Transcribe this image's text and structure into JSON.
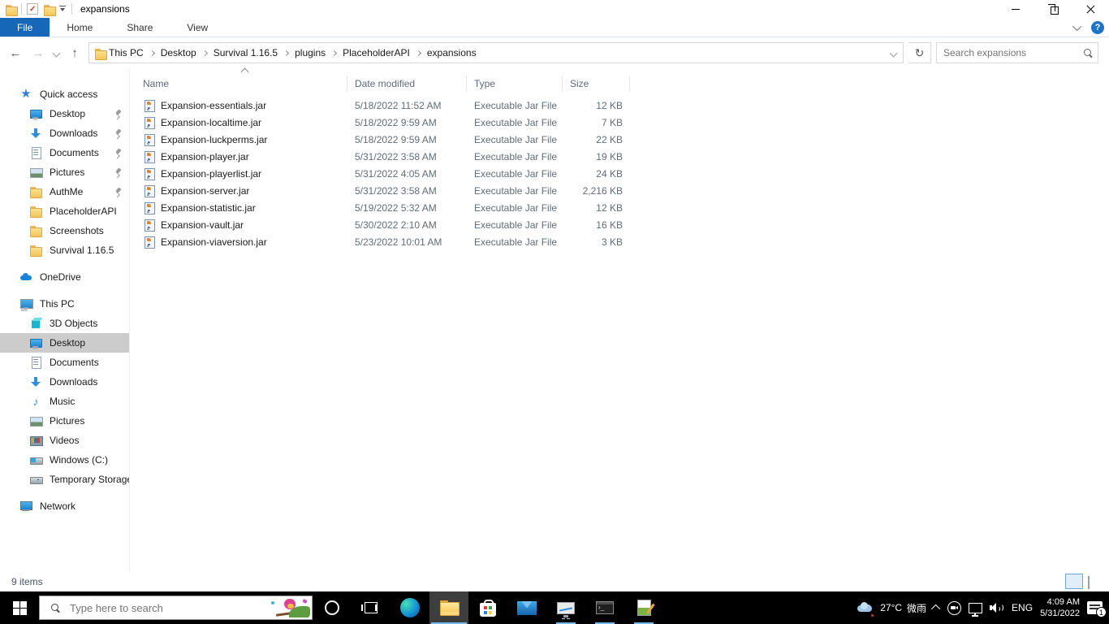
{
  "colors": {
    "accent_blue": "#1667b8",
    "selection_gray": "#cccccc",
    "taskbar_underline": "#76b9ed",
    "folder_yellow": "#f2c55e"
  },
  "titlebar": {
    "title": "expansions",
    "qat_icons": [
      "folder-icon",
      "properties-check-icon",
      "new-folder-icon",
      "customize-chevron-icon"
    ]
  },
  "ribbon": {
    "tabs": [
      "File",
      "Home",
      "Share",
      "View"
    ],
    "active_tab": "File",
    "help_label": "?"
  },
  "addressbar": {
    "breadcrumb": [
      "This PC",
      "Desktop",
      "Survival 1.16.5",
      "plugins",
      "PlaceholderAPI",
      "expansions"
    ],
    "search_placeholder": "Search expansions"
  },
  "sidebar": {
    "items": [
      {
        "label": "Quick access",
        "icon": "star",
        "level": 0,
        "pinned": false,
        "selected": false,
        "gap": false
      },
      {
        "label": "Desktop",
        "icon": "desktop",
        "level": 1,
        "pinned": true,
        "selected": false,
        "gap": false
      },
      {
        "label": "Downloads",
        "icon": "download",
        "level": 1,
        "pinned": true,
        "selected": false,
        "gap": false
      },
      {
        "label": "Documents",
        "icon": "document",
        "level": 1,
        "pinned": true,
        "selected": false,
        "gap": false
      },
      {
        "label": "Pictures",
        "icon": "picture",
        "level": 1,
        "pinned": true,
        "selected": false,
        "gap": false
      },
      {
        "label": "AuthMe",
        "icon": "folder",
        "level": 1,
        "pinned": true,
        "selected": false,
        "gap": false
      },
      {
        "label": "PlaceholderAPI",
        "icon": "folder",
        "level": 1,
        "pinned": false,
        "selected": false,
        "gap": false
      },
      {
        "label": "Screenshots",
        "icon": "folder",
        "level": 1,
        "pinned": false,
        "selected": false,
        "gap": false
      },
      {
        "label": "Survival 1.16.5",
        "icon": "folder",
        "level": 1,
        "pinned": false,
        "selected": false,
        "gap": false
      },
      {
        "label": "OneDrive",
        "icon": "cloud",
        "level": 0,
        "pinned": false,
        "selected": false,
        "gap": true
      },
      {
        "label": "This PC",
        "icon": "pc",
        "level": 0,
        "pinned": false,
        "selected": false,
        "gap": true
      },
      {
        "label": "3D Objects",
        "icon": "cube",
        "level": 1,
        "pinned": false,
        "selected": false,
        "gap": false
      },
      {
        "label": "Desktop",
        "icon": "desktop",
        "level": 1,
        "pinned": false,
        "selected": true,
        "gap": false
      },
      {
        "label": "Documents",
        "icon": "document",
        "level": 1,
        "pinned": false,
        "selected": false,
        "gap": false
      },
      {
        "label": "Downloads",
        "icon": "download",
        "level": 1,
        "pinned": false,
        "selected": false,
        "gap": false
      },
      {
        "label": "Music",
        "icon": "music",
        "level": 1,
        "pinned": false,
        "selected": false,
        "gap": false
      },
      {
        "label": "Pictures",
        "icon": "picture",
        "level": 1,
        "pinned": false,
        "selected": false,
        "gap": false
      },
      {
        "label": "Videos",
        "icon": "video",
        "level": 1,
        "pinned": false,
        "selected": false,
        "gap": false
      },
      {
        "label": "Windows (C:)",
        "icon": "disk-os",
        "level": 1,
        "pinned": false,
        "selected": false,
        "gap": false
      },
      {
        "label": "Temporary Storage",
        "icon": "disk",
        "level": 1,
        "pinned": false,
        "selected": false,
        "gap": false
      },
      {
        "label": "Network",
        "icon": "network",
        "level": 0,
        "pinned": false,
        "selected": false,
        "gap": true
      }
    ]
  },
  "files": {
    "columns": [
      {
        "label": "Name",
        "sort": "asc"
      },
      {
        "label": "Date modified",
        "sort": null
      },
      {
        "label": "Type",
        "sort": null
      },
      {
        "label": "Size",
        "sort": null
      }
    ],
    "rows": [
      {
        "name": "Expansion-essentials.jar",
        "date": "5/18/2022 11:52 AM",
        "type": "Executable Jar File",
        "size": "12 KB"
      },
      {
        "name": "Expansion-localtime.jar",
        "date": "5/18/2022 9:59 AM",
        "type": "Executable Jar File",
        "size": "7 KB"
      },
      {
        "name": "Expansion-luckperms.jar",
        "date": "5/18/2022 9:59 AM",
        "type": "Executable Jar File",
        "size": "22 KB"
      },
      {
        "name": "Expansion-player.jar",
        "date": "5/31/2022 3:58 AM",
        "type": "Executable Jar File",
        "size": "19 KB"
      },
      {
        "name": "Expansion-playerlist.jar",
        "date": "5/31/2022 4:05 AM",
        "type": "Executable Jar File",
        "size": "24 KB"
      },
      {
        "name": "Expansion-server.jar",
        "date": "5/31/2022 3:58 AM",
        "type": "Executable Jar File",
        "size": "2,216 KB"
      },
      {
        "name": "Expansion-statistic.jar",
        "date": "5/19/2022 5:32 AM",
        "type": "Executable Jar File",
        "size": "12 KB"
      },
      {
        "name": "Expansion-vault.jar",
        "date": "5/30/2022 2:10 AM",
        "type": "Executable Jar File",
        "size": "16 KB"
      },
      {
        "name": "Expansion-viaversion.jar",
        "date": "5/23/2022 10:01 AM",
        "type": "Executable Jar File",
        "size": "3 KB"
      }
    ]
  },
  "statusbar": {
    "items_count": "9 items",
    "views": [
      "details-view",
      "thumbnails-view"
    ],
    "active_view": "details-view"
  },
  "taskbar": {
    "search_placeholder": "Type here to search",
    "apps": [
      {
        "name": "cortana",
        "state": "idle"
      },
      {
        "name": "task-view",
        "state": "idle"
      },
      {
        "name": "edge",
        "state": "idle"
      },
      {
        "name": "file-explorer",
        "state": "active"
      },
      {
        "name": "store",
        "state": "idle"
      },
      {
        "name": "mail",
        "state": "idle"
      },
      {
        "name": "system-monitor",
        "state": "running"
      },
      {
        "name": "terminal",
        "state": "running"
      },
      {
        "name": "notes",
        "state": "running"
      }
    ],
    "tray": {
      "weather_temp": "27°C",
      "weather_desc": "微雨",
      "language": "ENG",
      "time": "4:09 AM",
      "date": "5/31/2022",
      "notification_badge": "1"
    }
  }
}
